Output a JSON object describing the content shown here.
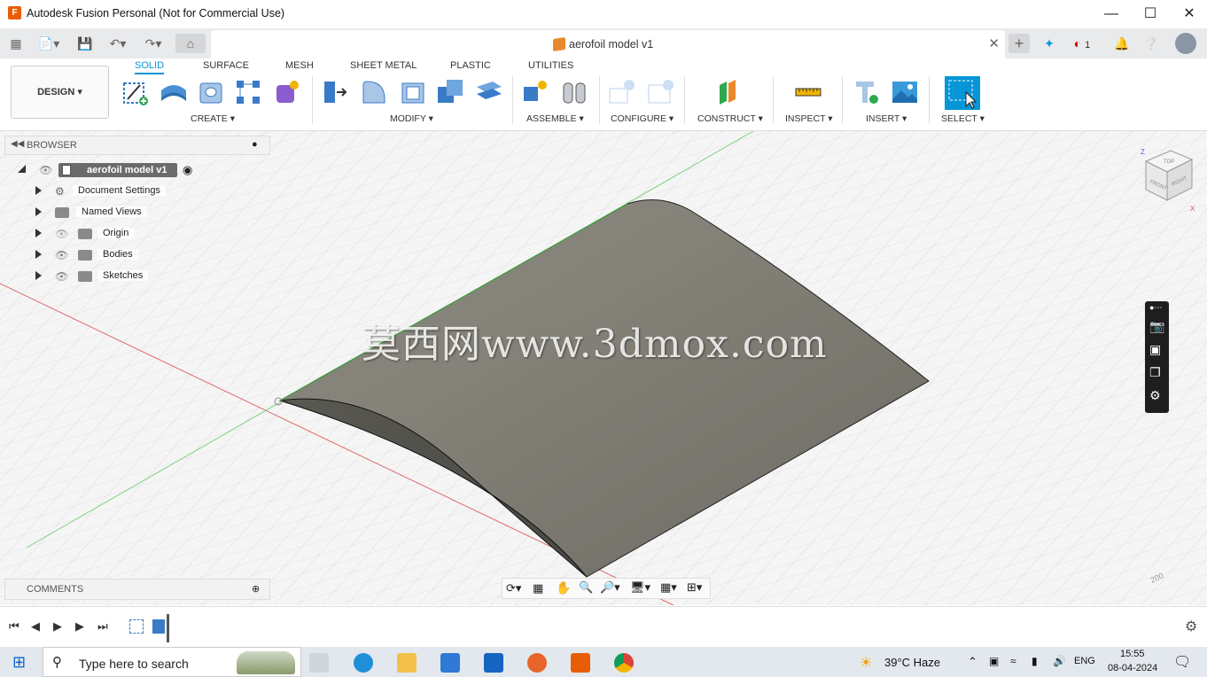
{
  "window": {
    "title": "Autodesk Fusion Personal (Not for Commercial Use)",
    "controls": [
      "minimize-icon",
      "maximize-icon",
      "close-icon"
    ]
  },
  "quick_access": {
    "document_tab_title": "aerofoil model v1",
    "notifications_count": "1"
  },
  "ribbon": {
    "workspace_button": "DESIGN",
    "tabs": [
      {
        "label": "SOLID",
        "active": true
      },
      {
        "label": "SURFACE",
        "active": false
      },
      {
        "label": "MESH",
        "active": false
      },
      {
        "label": "SHEET METAL",
        "active": false
      },
      {
        "label": "PLASTIC",
        "active": false
      },
      {
        "label": "UTILITIES",
        "active": false
      }
    ],
    "groups": [
      "CREATE",
      "MODIFY",
      "ASSEMBLE",
      "CONFIGURE",
      "CONSTRUCT",
      "INSPECT",
      "INSERT",
      "SELECT"
    ]
  },
  "browser": {
    "header": "BROWSER",
    "root": "aerofoil model v1",
    "items": [
      {
        "label": "Document Settings",
        "icon": "gear-icon"
      },
      {
        "label": "Named Views",
        "icon": "folder-icon"
      },
      {
        "label": "Origin",
        "icon": "folder-icon"
      },
      {
        "label": "Bodies",
        "icon": "folder-icon"
      },
      {
        "label": "Sketches",
        "icon": "folder-icon"
      }
    ]
  },
  "comments": {
    "header": "COMMENTS"
  },
  "viewcube": {
    "faces": [
      "TOP",
      "FRONT",
      "RIGHT"
    ],
    "axis_labels": [
      "Z",
      "X"
    ]
  },
  "viewport": {
    "watermark": "莫西网www.3dmox.com",
    "grid_label": "200"
  },
  "taskbar": {
    "search_placeholder": "Type here to search",
    "weather": "39°C  Haze",
    "language": "ENG",
    "time": "15:55",
    "date": "08-04-2024"
  },
  "colors": {
    "accent": "#0696d7",
    "body_fill": "#7a786e",
    "fusion_orange": "#e85d04"
  }
}
